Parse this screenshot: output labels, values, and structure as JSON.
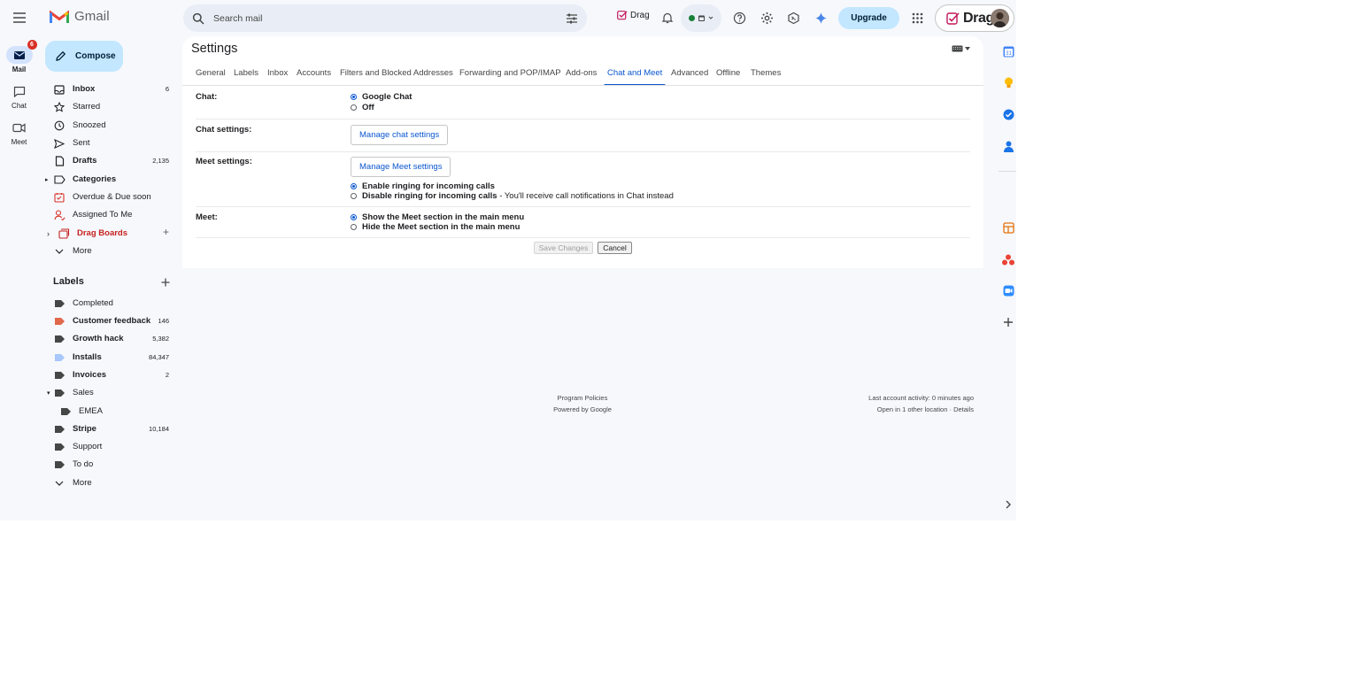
{
  "app": {
    "logo_text": "Gmail"
  },
  "header": {
    "search_placeholder": "Search mail",
    "drag_extension_label": "Drag",
    "upgrade_label": "Upgrade",
    "drag_account_label": "Drag",
    "status_color": "#188038"
  },
  "rail": {
    "mail": {
      "label": "Mail",
      "badge": "6"
    },
    "chat": {
      "label": "Chat"
    },
    "meet": {
      "label": "Meet"
    }
  },
  "compose_label": "Compose",
  "nav": {
    "items": [
      {
        "label": "Inbox",
        "count": "6",
        "icon": "inbox-icon"
      },
      {
        "label": "Starred",
        "count": "",
        "icon": "star-icon"
      },
      {
        "label": "Snoozed",
        "count": "",
        "icon": "clock-icon"
      },
      {
        "label": "Sent",
        "count": "",
        "icon": "send-icon"
      },
      {
        "label": "Drafts",
        "count": "2,135",
        "icon": "draft-icon"
      },
      {
        "label": "Categories",
        "count": "",
        "icon": "label-outline-icon"
      },
      {
        "label": "Overdue & Due soon",
        "count": "",
        "icon": "calendar-alert-icon"
      },
      {
        "label": "Assigned To Me",
        "count": "",
        "icon": "person-assigned-icon"
      },
      {
        "label": "Drag Boards",
        "count": "",
        "icon": "drag-boards-icon"
      },
      {
        "label": "More",
        "count": "",
        "icon": "chevron-down-icon"
      }
    ]
  },
  "labels": {
    "title": "Labels",
    "items": [
      {
        "label": "Completed",
        "count": "",
        "color": "#444746"
      },
      {
        "label": "Customer feedback",
        "count": "146",
        "color": "#e0684b"
      },
      {
        "label": "Growth hack",
        "count": "5,382",
        "color": "#444746"
      },
      {
        "label": "Installs",
        "count": "84,347",
        "color": "#a8c7fa"
      },
      {
        "label": "Invoices",
        "count": "2",
        "color": "#444746"
      },
      {
        "label": "Sales",
        "count": "",
        "color": "#444746"
      },
      {
        "label": "EMEA",
        "count": "",
        "color": "#444746"
      },
      {
        "label": "Stripe",
        "count": "10,184",
        "color": "#444746"
      },
      {
        "label": "Support",
        "count": "",
        "color": "#444746"
      },
      {
        "label": "To do",
        "count": "",
        "color": "#444746"
      },
      {
        "label": "More",
        "count": "",
        "color": ""
      }
    ]
  },
  "settings": {
    "title": "Settings",
    "tabs": [
      "General",
      "Labels",
      "Inbox",
      "Accounts",
      "Filters and Blocked Addresses",
      "Forwarding and POP/IMAP",
      "Add-ons",
      "Chat and Meet",
      "Advanced",
      "Offline",
      "Themes"
    ],
    "active_tab": "Chat and Meet",
    "chat": {
      "label": "Chat:",
      "options": [
        "Google Chat",
        "Off"
      ],
      "selected": "Google Chat"
    },
    "chat_settings": {
      "label": "Chat settings:",
      "button": "Manage chat settings"
    },
    "meet_settings": {
      "label": "Meet settings:",
      "button": "Manage Meet settings",
      "ringing_on": "Enable ringing for incoming calls",
      "ringing_off": "Disable ringing for incoming calls",
      "ringing_off_note": " - You'll receive call notifications in Chat instead",
      "selected": "Enable ringing for incoming calls"
    },
    "meet": {
      "label": "Meet:",
      "options": [
        "Show the Meet section in the main menu",
        "Hide the Meet section in the main menu"
      ],
      "selected": "Show the Meet section in the main menu"
    },
    "save_label": "Save Changes",
    "cancel_label": "Cancel"
  },
  "footer": {
    "policies": "Program Policies",
    "powered": "Powered by Google",
    "activity": "Last account activity: 0 minutes ago",
    "other_location": "Open in 1 other location · ",
    "details": "Details"
  },
  "side_panel": {
    "icons": [
      "calendar-icon",
      "keep-icon",
      "tasks-icon",
      "contacts-icon",
      "drag-addon-icon",
      "community-addon-icon",
      "zoom-addon-icon",
      "add-icon",
      "expand-icon"
    ]
  }
}
